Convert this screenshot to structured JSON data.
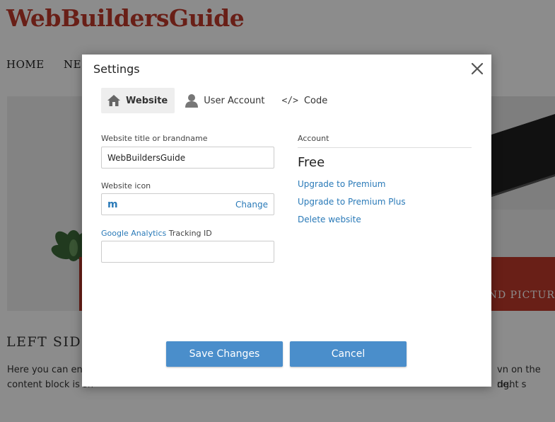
{
  "site": {
    "brand": "WebBuildersGuide",
    "nav": [
      "HOME",
      "NE"
    ],
    "banner_text": "UND PICTUR",
    "section_title": "LEFT SIDE",
    "paragraph": {
      "line1": "Here you can ente",
      "line2": "content block is sh",
      "line1_right": "vn on the right s",
      "line2_right": "de."
    }
  },
  "dialog": {
    "title": "Settings",
    "close_icon": "close-icon",
    "tabs": [
      {
        "label": "Website",
        "icon": "home-icon",
        "active": true
      },
      {
        "label": "User Account",
        "icon": "user-icon",
        "active": false
      },
      {
        "label": "Code",
        "icon": "code-icon",
        "glyph": "</>",
        "active": false
      }
    ],
    "website_title": {
      "label": "Website title or brandname",
      "value": "WebBuildersGuide"
    },
    "website_icon": {
      "label": "Website icon",
      "icon_glyph": "m",
      "change_label": "Change"
    },
    "analytics": {
      "link_label": "Google Analytics",
      "label_suffix": " Tracking ID",
      "value": ""
    },
    "account": {
      "heading": "Account",
      "plan": "Free",
      "links": [
        "Upgrade to Premium",
        "Upgrade to Premium Plus",
        "Delete website"
      ]
    },
    "buttons": {
      "save": "Save Changes",
      "cancel": "Cancel"
    },
    "colors": {
      "accent": "#4a8ecb",
      "link": "#2a7ab8",
      "brand": "#c0392b"
    }
  }
}
